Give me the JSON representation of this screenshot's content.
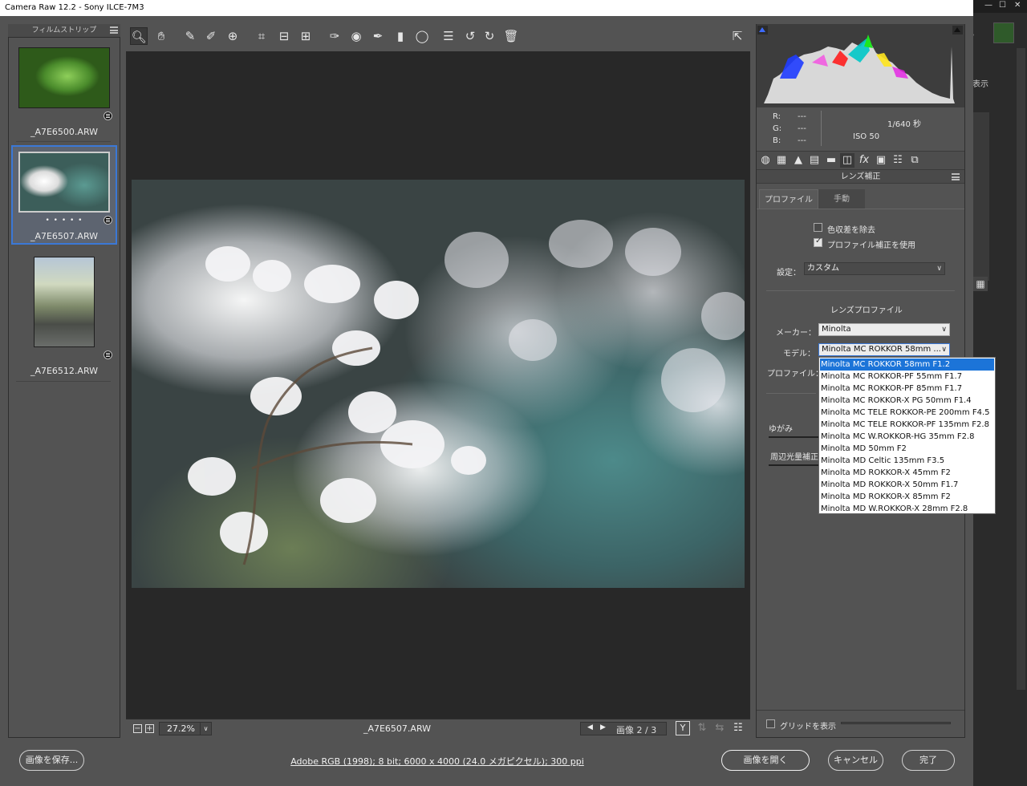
{
  "window": {
    "title": "Camera Raw 12.2  -  Sony ILCE-7M3"
  },
  "bg_app": {
    "partial_text": "表示",
    "controls": [
      "—",
      "☐",
      "✕"
    ]
  },
  "filmstrip": {
    "header": "フィルムストリップ",
    "items": [
      {
        "name": "_A7E6500.ARW",
        "selected": false,
        "rating": ""
      },
      {
        "name": "_A7E6507.ARW",
        "selected": true,
        "rating": "• • • • •"
      },
      {
        "name": "_A7E6512.ARW",
        "selected": false,
        "rating": ""
      }
    ]
  },
  "toolbar": {
    "tools": [
      "zoom-tool",
      "hand-tool",
      "white-balance-tool",
      "color-sampler-tool",
      "targeted-adjustment-tool",
      "crop-tool",
      "straighten-tool",
      "transform-tool",
      "spot-removal-tool",
      "red-eye-tool",
      "adjustment-brush",
      "graduated-filter",
      "radial-filter",
      "presets-list",
      "rotate-left",
      "rotate-right",
      "delete"
    ],
    "active_tool": "zoom-tool"
  },
  "preview": {
    "zoom": "27.2%",
    "filename": "_A7E6507.ARW",
    "image_counter": "画像 2 / 3"
  },
  "info": {
    "r_label": "R:",
    "g_label": "G:",
    "b_label": "B:",
    "r": "---",
    "g": "---",
    "b": "---",
    "shutter": "1/640 秒",
    "iso": "ISO 50"
  },
  "panel": {
    "title": "レンズ補正",
    "tabs": {
      "profile": "プロファイル",
      "manual": "手動"
    },
    "remove_ca": {
      "label": "色収差を除去",
      "checked": false
    },
    "use_profile": {
      "label": "プロファイル補正を使用",
      "checked": true
    },
    "setup_label": "設定：",
    "setup_value": "カスタム",
    "lens_profile_heading": "レンズプロファイル",
    "maker_label": "メーカー：",
    "maker_value": "Minolta",
    "model_label": "モデル：",
    "model_value": "Minolta MC ROKKOR 58mm ...",
    "profile_label": "プロファイル：",
    "distortion_label": "ゆがみ",
    "vignette_label": "周辺光量補正",
    "show_grid_label": "グリッドを表示",
    "show_grid_checked": false
  },
  "model_dropdown": {
    "selected_index": 0,
    "options": [
      "Minolta MC ROKKOR 58mm F1.2",
      "Minolta MC ROKKOR-PF 55mm F1.7",
      "Minolta MC ROKKOR-PF 85mm F1.7",
      "Minolta MC ROKKOR-X PG 50mm F1.4",
      "Minolta MC TELE ROKKOR-PE 200mm F4.5",
      "Minolta MC TELE ROKKOR-PF 135mm F2.8",
      "Minolta MC W.ROKKOR-HG 35mm F2.8",
      "Minolta MD 50mm F2",
      "Minolta MD Celtic 135mm F3.5",
      "Minolta MD ROKKOR-X 45mm F2",
      "Minolta MD ROKKOR-X 50mm F1.7",
      "Minolta MD ROKKOR-X 85mm F2",
      "Minolta MD W.ROKKOR-X 28mm F2.8"
    ]
  },
  "footer": {
    "save_button": "画像を保存...",
    "workflow_info": "Adobe RGB (1998); 8 bit; 6000 x 4000 (24.0 メガピクセル); 300 ppi",
    "open_button": "画像を開く",
    "cancel_button": "キャンセル",
    "done_button": "完了"
  },
  "colors": {
    "accent": "#1c74d8",
    "selection_border": "#3b78d6",
    "panel_bg": "#535353",
    "preview_bg": "#282828"
  }
}
